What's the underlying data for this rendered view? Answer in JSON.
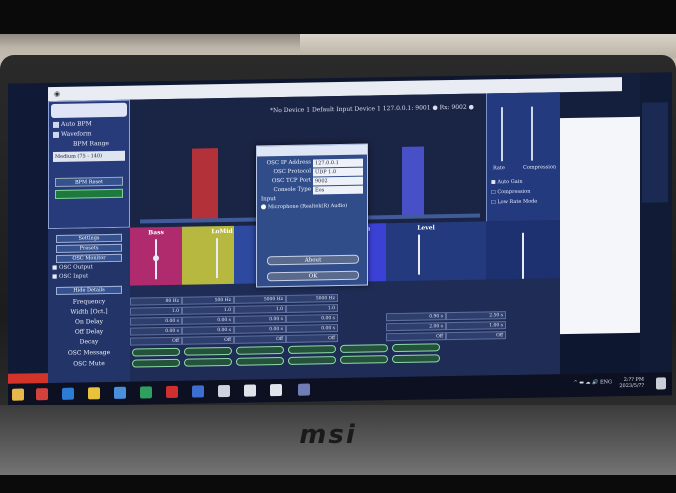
{
  "brand": {
    "laptop_logo": "msi"
  },
  "window": {
    "status_line": "*No Device 1  Default Input Device 1  127.0.0.1: 9001 ●  Rx: 9002 ●"
  },
  "sidebar": {
    "auto_bpm": "Auto BPM",
    "waveform": "Waveform",
    "bpm_range_label": "BPM Range",
    "bpm_range_value": "Medium (75 - 140)",
    "bpm_reset": "BPM Reset"
  },
  "left_buttons": {
    "settings": "Settings",
    "presets": "Presets",
    "osc_monitor": "OSC Monitor",
    "osc_output": "OSC Output",
    "osc_input": "OSC Input",
    "hide_details": "Hide Details"
  },
  "params": {
    "frequency": "Frequency",
    "width": "Width [Oct.]",
    "on_delay": "On Delay",
    "off_delay": "Off Delay",
    "decay": "Decay",
    "osc_message": "OSC Message",
    "osc_mute": "OSC Mute"
  },
  "channels": {
    "bass": "Bass",
    "lowmid": "LoMid",
    "high": "High",
    "level": "Level"
  },
  "grid": {
    "freq_row": [
      "80 Hz",
      "500 Hz",
      "5000 Hz",
      "5000 Hz"
    ],
    "width_row": [
      "1.0",
      "1.0",
      "1.0",
      "1.0"
    ],
    "on_delay_row": [
      "0.00 s",
      "0.00 s",
      "0.00 s",
      "0.00 s",
      "0.90 s",
      "2.50 s"
    ],
    "off_delay_row": [
      "0.00 s",
      "0.00 s",
      "0.00 s",
      "0.00 s",
      "2.00 s",
      "1.00 s"
    ],
    "decay_row": [
      "Off",
      "Off",
      "Off",
      "Off",
      "Off",
      "Off"
    ]
  },
  "right_panel": {
    "rate_label": "Rate",
    "compression_label": "Compression",
    "auto_gain": "Auto Gain",
    "compression_on": "Compression",
    "low_rate_mode": "Low Rate Mode"
  },
  "dialog": {
    "osc_ip_label": "OSC IP Address",
    "osc_ip_value": "127.0.0.1",
    "osc_protocol_label": "OSC Protocol",
    "osc_protocol_value": "UDP 1.0",
    "osc_tcp_label": "OSC TCP Port",
    "osc_tcp_value": "9002",
    "console_type_label": "Console Type",
    "console_type_value": "Eos",
    "input_label": "Input",
    "input_option": "Microphone (Realtek(R) Audio)",
    "about_button": "About",
    "ok_button": "OK"
  },
  "taskbar": {
    "tray_text": "ENG",
    "time": "2:?? PM",
    "date": "2023/5/??"
  },
  "colors": {
    "accent_blue": "#2b44a0",
    "bass_color": "#b02a6e",
    "lowmid_color": "#b7b83f",
    "high_color": "#3c41d6",
    "red_bar": "#b3323a"
  }
}
